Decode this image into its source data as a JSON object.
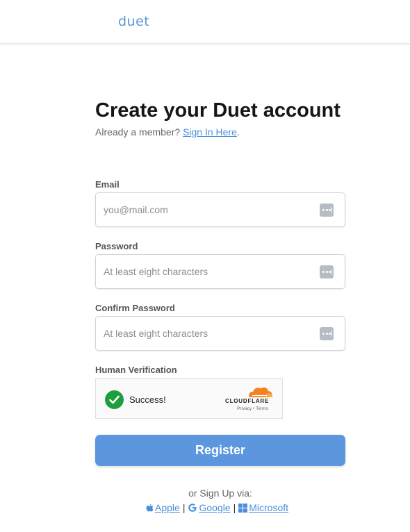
{
  "header": {
    "logo_text": "duet"
  },
  "main": {
    "title": "Create your Duet account",
    "member_prompt": "Already a member?",
    "sign_in_link": "Sign In Here",
    "sign_in_suffix": "."
  },
  "form": {
    "email": {
      "label": "Email",
      "placeholder": "you@mail.com",
      "value": ""
    },
    "password": {
      "label": "Password",
      "placeholder": "At least eight characters",
      "value": ""
    },
    "confirm_password": {
      "label": "Confirm Password",
      "placeholder": "At least eight characters",
      "value": ""
    },
    "verification": {
      "label": "Human Verification",
      "status": "Success!",
      "provider": "CLOUDFLARE",
      "privacy_link": "Privacy",
      "separator": "•",
      "terms_link": "Terms"
    },
    "register_label": "Register"
  },
  "alt_signup": {
    "title": "or Sign Up via:",
    "apple_label": "Apple",
    "google_label": "Google",
    "microsoft_label": "Microsoft",
    "separator": "|"
  },
  "colors": {
    "accent": "#5b96de",
    "link": "#4a8fdc",
    "success": "#1e9e3f",
    "cloudflare_orange": "#f48120"
  },
  "icons": {
    "password_manager": "password-manager-icon",
    "checkmark": "check-icon",
    "apple": "apple-icon",
    "google": "google-icon",
    "microsoft": "microsoft-icon"
  }
}
